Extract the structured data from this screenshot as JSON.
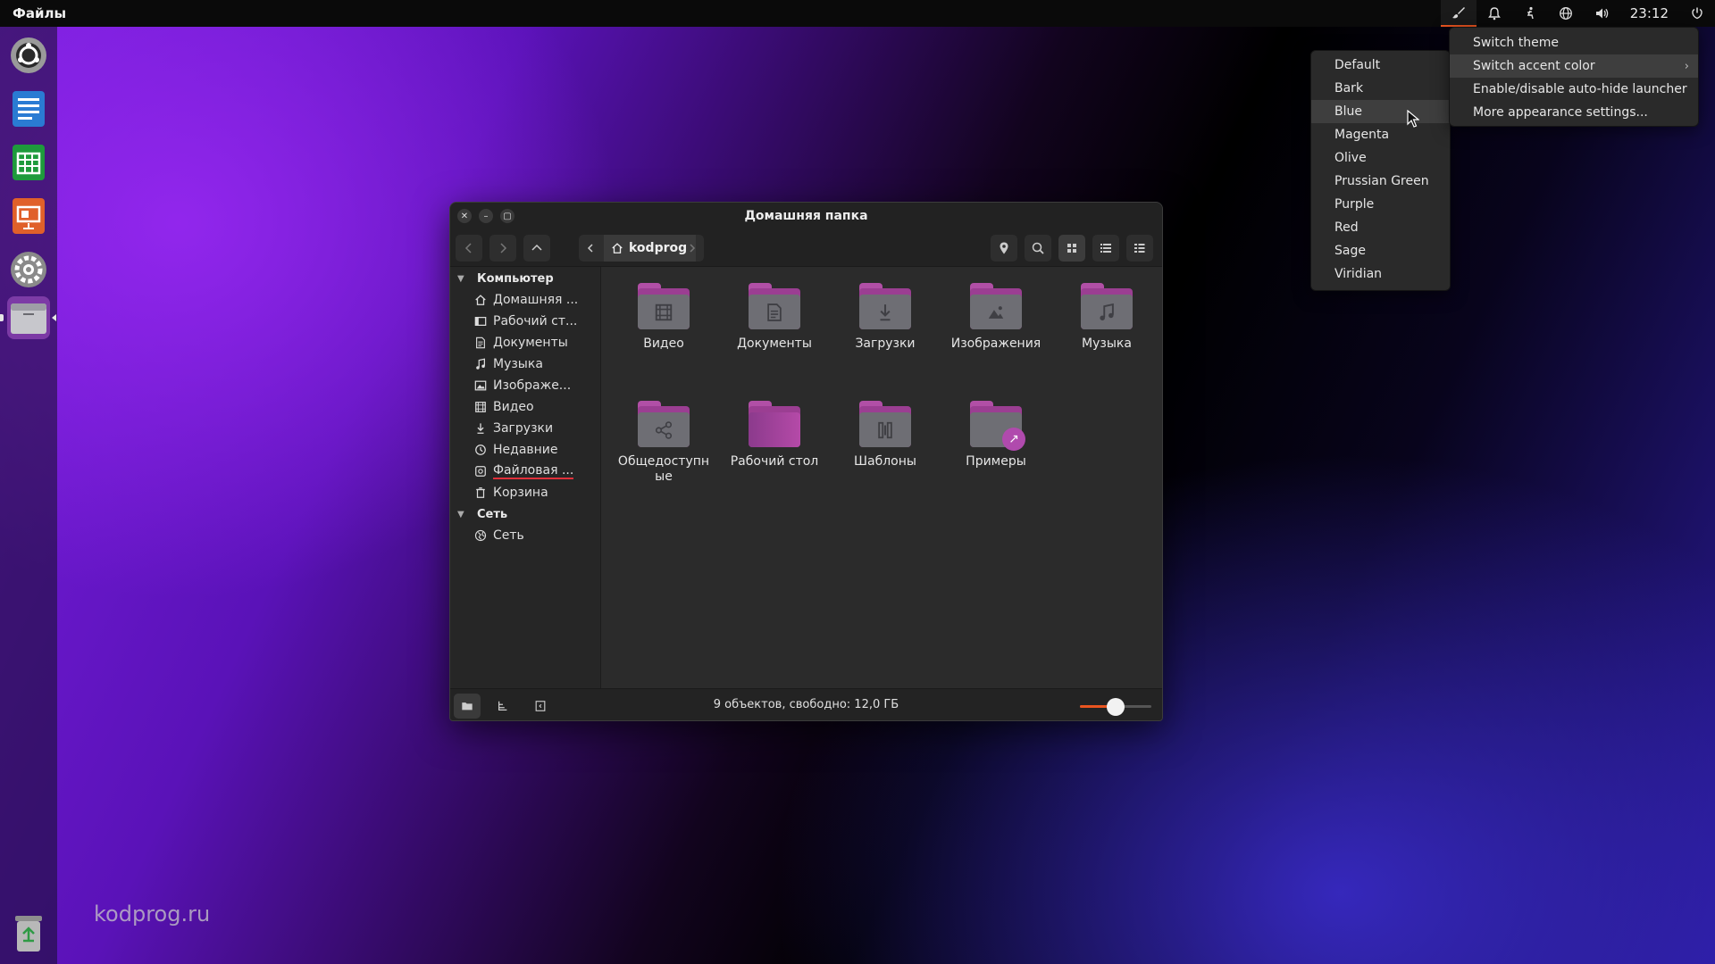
{
  "topbar": {
    "app_name": "Файлы",
    "clock": "23:12",
    "tray_icons": [
      "paintbrush-icon",
      "bell-icon",
      "accessibility-icon",
      "globe-icon",
      "volume-icon",
      "power-icon"
    ]
  },
  "launcher": {
    "apps": [
      "ubuntu-software-icon",
      "writer-icon",
      "calc-icon",
      "impress-icon",
      "settings-icon",
      "files-icon",
      "trash-icon"
    ]
  },
  "watermark": "kodprog.ru",
  "window": {
    "title": "Домашняя папка",
    "path": "kodprog",
    "sidebar": {
      "computer_header": "Компьютер",
      "computer_items": [
        {
          "label": "Домашняя ...",
          "icon": "home-icon"
        },
        {
          "label": "Рабочий ст...",
          "icon": "desktop-icon"
        },
        {
          "label": "Документы",
          "icon": "document-icon"
        },
        {
          "label": "Музыка",
          "icon": "music-icon"
        },
        {
          "label": "Изображе...",
          "icon": "image-icon"
        },
        {
          "label": "Видео",
          "icon": "video-icon"
        },
        {
          "label": "Загрузки",
          "icon": "download-icon"
        },
        {
          "label": "Недавние",
          "icon": "clock-icon"
        },
        {
          "label": "Файловая ...",
          "icon": "disk-icon"
        },
        {
          "label": "Корзина",
          "icon": "trash-icon"
        }
      ],
      "network_header": "Сеть",
      "network_items": [
        {
          "label": "Сеть",
          "icon": "network-icon"
        }
      ]
    },
    "files": [
      {
        "label": "Видео",
        "icon": "video-icon"
      },
      {
        "label": "Документы",
        "icon": "document-icon"
      },
      {
        "label": "Загрузки",
        "icon": "download-icon"
      },
      {
        "label": "Изображения",
        "icon": "image-icon"
      },
      {
        "label": "Музыка",
        "icon": "music-icon"
      },
      {
        "label": "Общедоступные",
        "icon": "share-icon"
      },
      {
        "label": "Рабочий стол",
        "icon": "desktop-icon"
      },
      {
        "label": "Шаблоны",
        "icon": "template-icon"
      },
      {
        "label": "Примеры",
        "icon": "link-icon"
      }
    ],
    "status": "9 объектов, свободно: 12,0 ГБ",
    "zoom_level": 0.5
  },
  "appearance_menu": {
    "items": [
      "Switch theme",
      "Switch accent color",
      "Enable/disable auto-hide launcher",
      "More appearance settings..."
    ],
    "highlighted": "Switch accent color"
  },
  "accent_menu": {
    "items": [
      "Default",
      "Bark",
      "Blue",
      "Magenta",
      "Olive",
      "Prussian Green",
      "Purple",
      "Red",
      "Sage",
      "Viridian"
    ],
    "highlighted": "Blue"
  }
}
